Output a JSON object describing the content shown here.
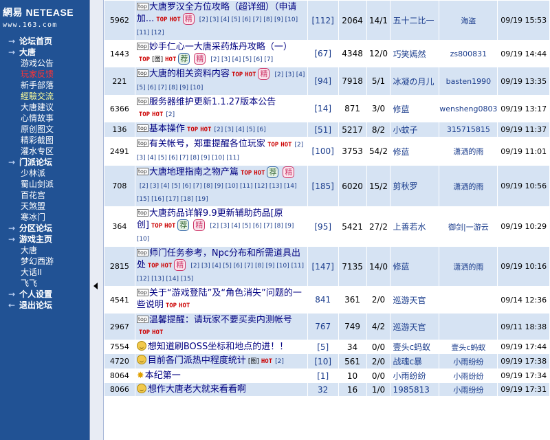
{
  "logo": {
    "brand_cn": "網易",
    "brand_en": "NETEASE",
    "url": "www.163.com"
  },
  "nav": [
    {
      "label": "论坛首页",
      "type": "sec",
      "arrow": "→"
    },
    {
      "label": "大唐",
      "type": "sec",
      "arrow": "→"
    },
    {
      "label": "游戏公告",
      "type": "sub"
    },
    {
      "label": "玩家反馈",
      "type": "sub red"
    },
    {
      "label": "新手部落",
      "type": "sub"
    },
    {
      "label": "經驗交流",
      "type": "sub hl"
    },
    {
      "label": "大唐建议",
      "type": "sub"
    },
    {
      "label": "心情故事",
      "type": "sub"
    },
    {
      "label": "原创图文",
      "type": "sub"
    },
    {
      "label": "精彩截图",
      "type": "sub"
    },
    {
      "label": "灌水专区",
      "type": "sub"
    },
    {
      "label": "门派论坛",
      "type": "sec",
      "arrow": "→"
    },
    {
      "label": "少林派",
      "type": "sub"
    },
    {
      "label": "蜀山剑派",
      "type": "sub"
    },
    {
      "label": "百花宫",
      "type": "sub"
    },
    {
      "label": "天煞盟",
      "type": "sub"
    },
    {
      "label": "寒冰门",
      "type": "sub"
    },
    {
      "label": "分区论坛",
      "type": "sec",
      "arrow": "→"
    },
    {
      "label": "游戏主页",
      "type": "sec",
      "arrow": "→"
    },
    {
      "label": "大唐",
      "type": "sub"
    },
    {
      "label": "梦幻西游",
      "type": "sub"
    },
    {
      "label": "大话II",
      "type": "sub"
    },
    {
      "label": "飞飞",
      "type": "sub"
    },
    {
      "label": "个人设置",
      "type": "sec",
      "arrow": "→"
    },
    {
      "label": "退出论坛",
      "type": "sec",
      "arrow": "←"
    }
  ],
  "labels": {
    "top": "TOP",
    "hot": "HOT",
    "pic": "[图]",
    "jing": "精",
    "jian": "荐",
    "tag": "top"
  },
  "rows": [
    {
      "id": "5962",
      "tag": true,
      "title": "大唐罗汉全方位攻略（超详细）（申请加...",
      "flags": [
        "top",
        "hot",
        "jing"
      ],
      "pages": "[2] [3] [4] [5] [6] [7] [8] [9] [10] [11] [12]",
      "replies": "[112]",
      "views": "2064",
      "ratio": "14/1",
      "author": "五十二比一",
      "last": "海盗",
      "time": "09/19 15:53"
    },
    {
      "id": "1443",
      "tag": true,
      "title": "妙手仁心一大唐采药炼丹攻略（一）",
      "flags": [
        "top",
        "pic",
        "hot",
        "jian",
        "jing"
      ],
      "pages": "[2] [3] [4] [5] [6] [7]",
      "replies": "[67]",
      "views": "4348",
      "ratio": "12/0",
      "author": "巧笑嫣然",
      "last": "zs800831",
      "time": "09/19 14:44"
    },
    {
      "id": "221",
      "tag": true,
      "title": "大唐的相关资料内容",
      "flags": [
        "top",
        "hot",
        "jing"
      ],
      "pages": "[2] [3] [4] [5] [6] [7] [8] [9] [10]",
      "replies": "[94]",
      "views": "7918",
      "ratio": "5/1",
      "author": "冰凝の月儿",
      "last": "basten1990",
      "time": "09/19 13:35"
    },
    {
      "id": "6366",
      "tag": true,
      "title": "服务器维护更新1.1.27版本公告",
      "flags": [
        "top",
        "hot"
      ],
      "pages": "[2]",
      "replies": "[14]",
      "views": "871",
      "ratio": "3/0",
      "author": "修蓝",
      "last": "wensheng0803",
      "time": "09/19 13:17"
    },
    {
      "id": "136",
      "tag": true,
      "title": "基本操作",
      "flags": [
        "top",
        "hot"
      ],
      "pages": "[2] [3] [4] [5] [6]",
      "replies": "[51]",
      "views": "5217",
      "ratio": "8/2",
      "author": "小蚊子",
      "last": "315715815",
      "time": "09/19 11:37"
    },
    {
      "id": "2491",
      "tag": true,
      "title": "有关帐号，郑重提醒各位玩家",
      "flags": [
        "top",
        "hot"
      ],
      "pages": "[2] [3] [4] [5] [6] [7] [8] [9] [10] [11]",
      "replies": "[100]",
      "views": "3753",
      "ratio": "54/2",
      "author": "修蓝",
      "last": "潇洒的雨",
      "time": "09/19 11:01"
    },
    {
      "id": "708",
      "tag": true,
      "title": "大唐地理指南之物产篇",
      "flags": [
        "top",
        "hot",
        "jian",
        "jing"
      ],
      "pages": "[2] [3] [4] [5] [6] [7] [8] [9] [10] [11] [12] [13] [14] [15] [16] [17] [18] [19]",
      "replies": "[185]",
      "views": "6020",
      "ratio": "15/2",
      "author": "剪秋罗",
      "last": "潇洒的雨",
      "time": "09/19 10:56"
    },
    {
      "id": "364",
      "tag": true,
      "title": "大唐药品详解9.9更新辅助药品[原创]",
      "flags": [
        "top",
        "hot",
        "jian",
        "jing"
      ],
      "pages": "[2] [3] [4] [5] [6] [7] [8] [9] [10]",
      "replies": "[95]",
      "views": "5421",
      "ratio": "27/2",
      "author": "上善若水",
      "last": "御剑|一游云",
      "time": "09/19 10:29"
    },
    {
      "id": "2815",
      "tag": true,
      "title": "师门任务参考，Npc分布和所需道具出处",
      "flags": [
        "top",
        "hot",
        "jing"
      ],
      "pages": "[2] [3] [4] [5] [6] [7] [8] [9] [10] [11] [12] [13] [14] [15]",
      "replies": "[147]",
      "views": "7135",
      "ratio": "14/0",
      "author": "修蓝",
      "last": "潇洒的雨",
      "time": "09/19 10:16"
    },
    {
      "id": "4541",
      "tag": true,
      "title": "关于“游戏登陆”及“角色消失”问题的一些说明",
      "flags": [
        "top",
        "hot"
      ],
      "pages": "",
      "replies": "841",
      "views": "361",
      "ratio": "2/0",
      "author": "巡游天官",
      "last": "",
      "time": "09/14 12:36"
    },
    {
      "id": "2967",
      "tag": true,
      "title": "温馨提醒：请玩家不要买卖内测帐号",
      "flags": [
        "top",
        "hot"
      ],
      "pages": "",
      "replies": "767",
      "views": "749",
      "ratio": "4/2",
      "author": "巡游天官",
      "last": "",
      "time": "09/11 18:38"
    },
    {
      "id": "7554",
      "icon": "smile",
      "title": "想知道刷BOSS坐标和地点的进！！",
      "flags": [],
      "pages": "",
      "replies": "[5]",
      "views": "34",
      "ratio": "0/0",
      "author": "壹头ⅽ蚂蚁",
      "last": "壹头ⅽ蚂蚁",
      "time": "09/19 17:44"
    },
    {
      "id": "4720",
      "icon": "smile",
      "title": "目前各门派热中程度统计",
      "flags": [
        "pic",
        "hot"
      ],
      "pages": "[2]",
      "replies": "[10]",
      "views": "561",
      "ratio": "2/0",
      "author": "战魂ⅽ暴",
      "last": "小雨纷纷",
      "time": "09/19 17:38"
    },
    {
      "id": "8064",
      "icon": "star",
      "title": "本纪第一",
      "flags": [],
      "pages": "",
      "replies": "[1]",
      "views": "10",
      "ratio": "0/0",
      "author": "小雨纷纷",
      "last": "小雨纷纷",
      "time": "09/19 17:34"
    },
    {
      "id": "8066",
      "icon": "smile",
      "title": "想作大唐老大就来看看啊",
      "flags": [],
      "pages": "",
      "replies": "32",
      "views": "16",
      "ratio": "1/0",
      "author": "1985813",
      "last": "小雨纷纷",
      "time": "09/19 17:31"
    }
  ]
}
